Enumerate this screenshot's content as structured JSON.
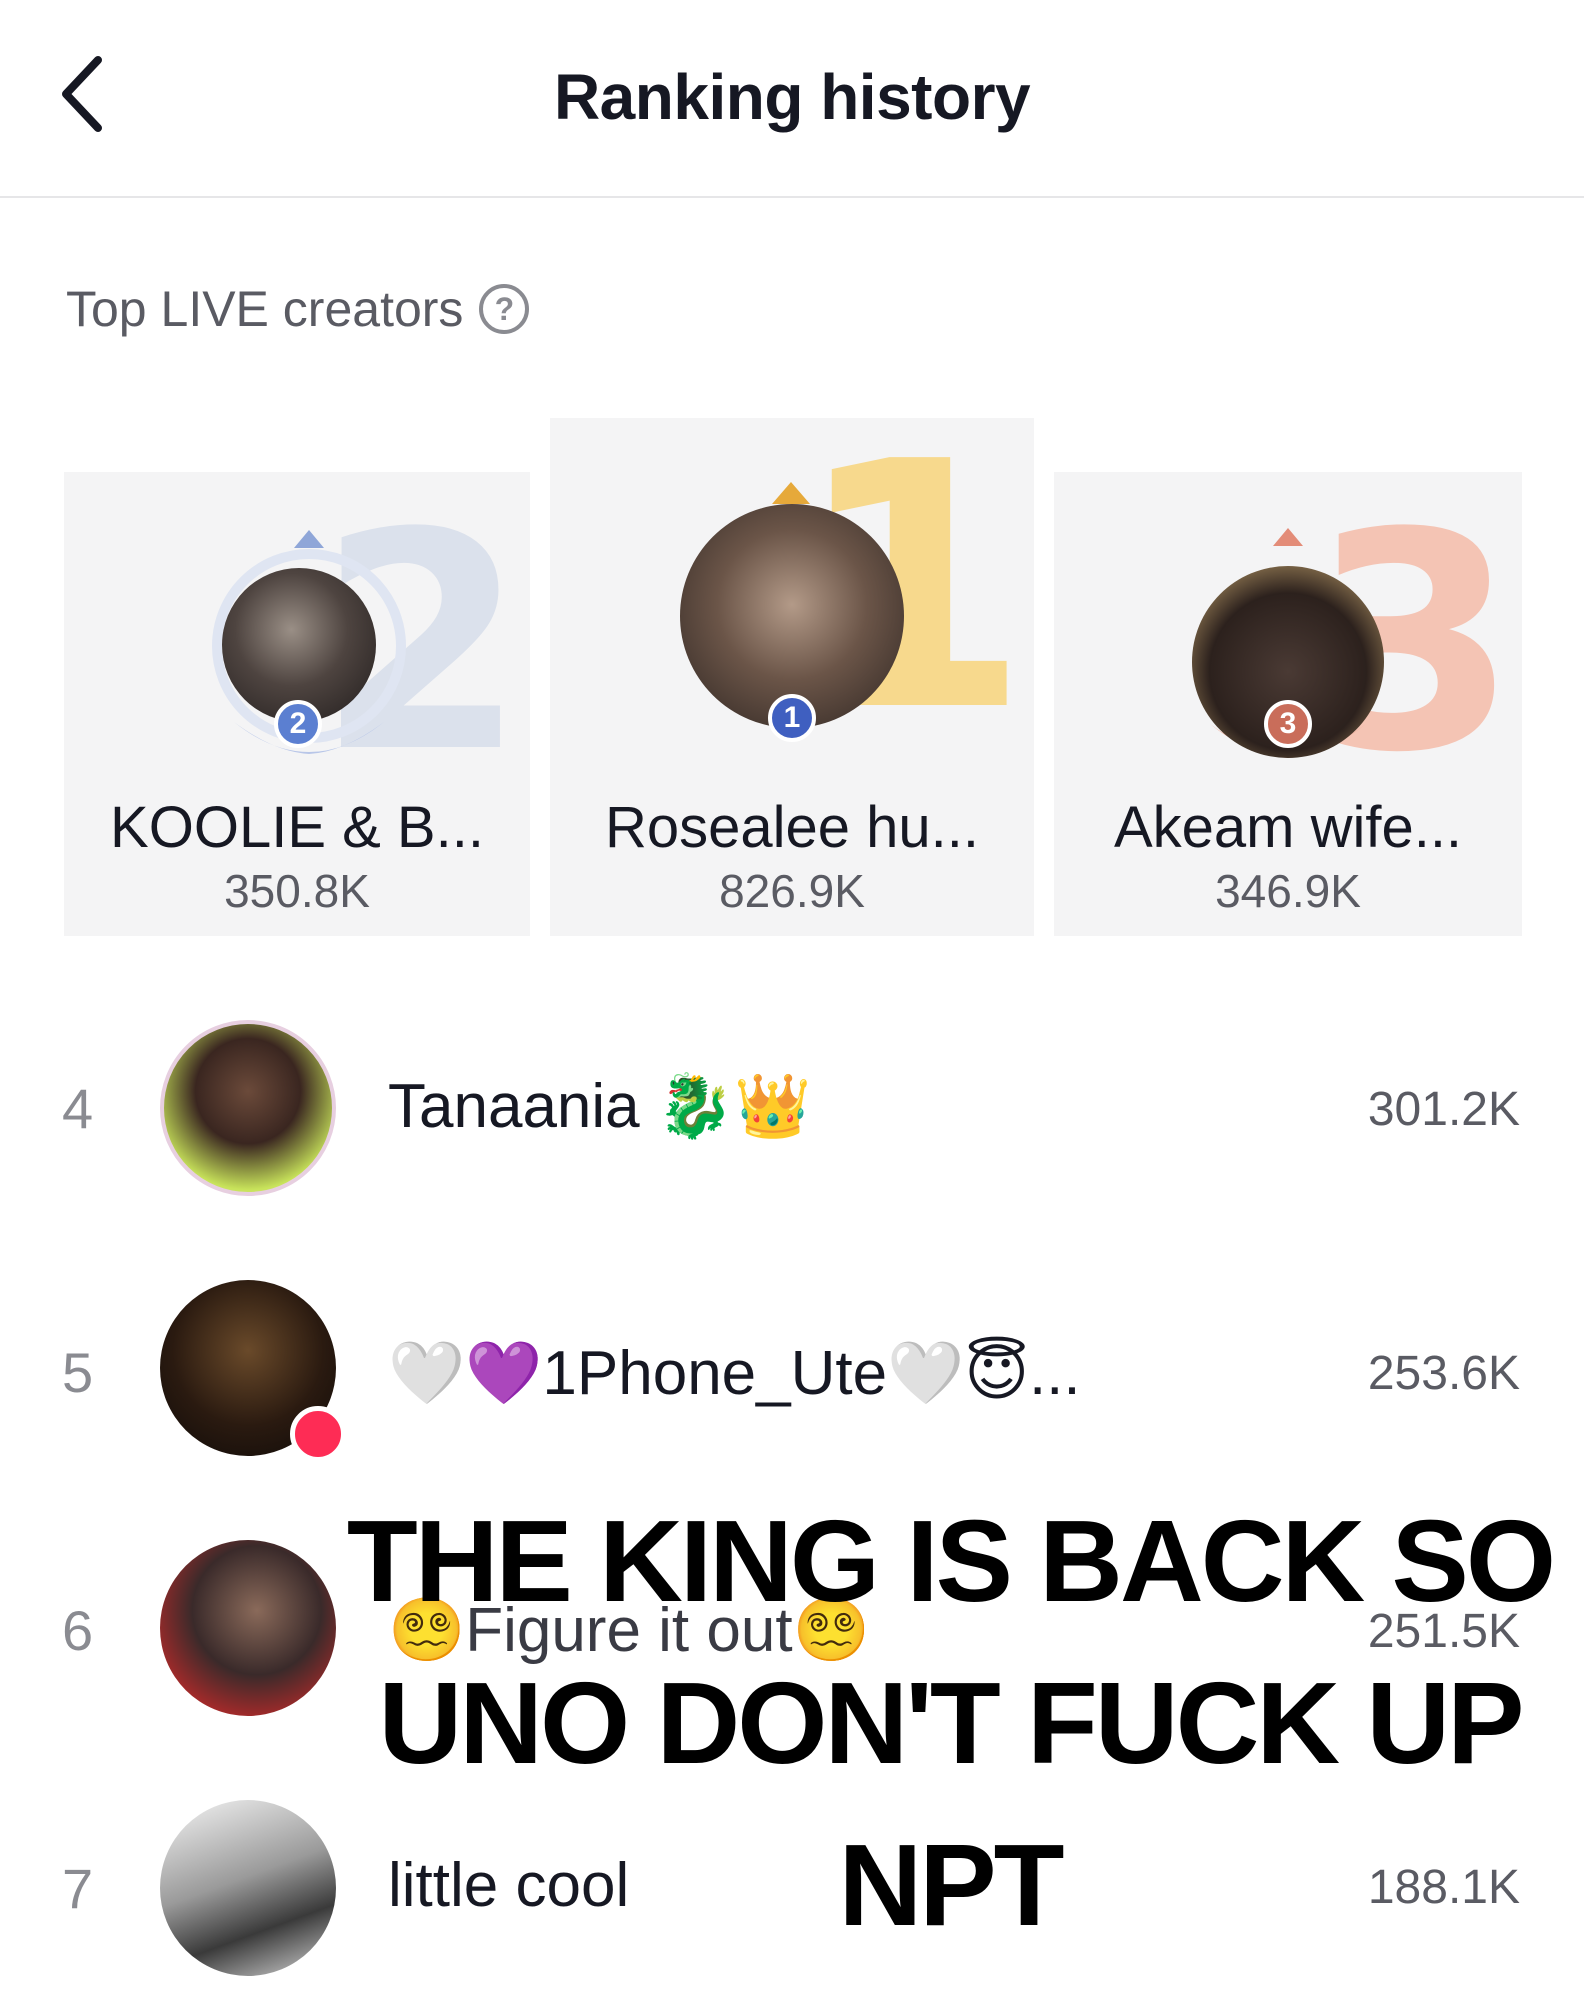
{
  "header": {
    "title": "Ranking history",
    "back_icon": "chevron-left-icon"
  },
  "section": {
    "label": "Top LIVE creators",
    "help_icon": "question-circle-icon"
  },
  "podium": [
    {
      "rank": "2",
      "name": "KOOLIE & B...",
      "score": "350.8K",
      "color": "#c9d2e4"
    },
    {
      "rank": "1",
      "name": "Rosealee hu...",
      "score": "826.9K",
      "color": "#f5c869"
    },
    {
      "rank": "3",
      "name": "Akeam wife...",
      "score": "346.9K",
      "color": "#f2b29a"
    }
  ],
  "list": [
    {
      "rank": "4",
      "name": "Tanaania 🐉👑",
      "score": "301.2K"
    },
    {
      "rank": "5",
      "name": "🤍💜1Phone_Ute🤍😇...",
      "score": "253.6K"
    },
    {
      "rank": "6",
      "name": "😵‍💫Figure it out😵‍💫",
      "score": "251.5K"
    },
    {
      "rank": "7",
      "name": "little cool",
      "score": "188.1K"
    }
  ],
  "overlay": {
    "line1": "THE KING IS BACK SO",
    "line2": "UNO DON'T FUCK UP",
    "line3": "NPT"
  }
}
